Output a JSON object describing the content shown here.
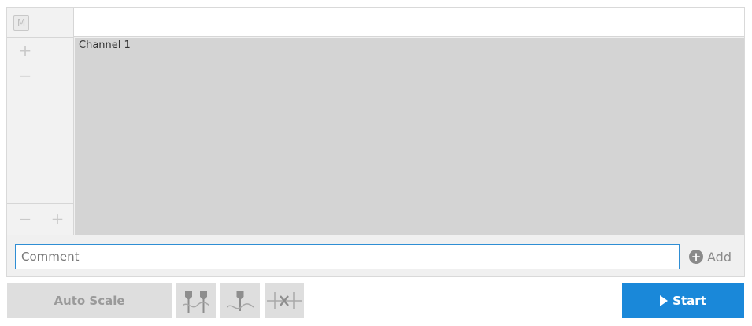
{
  "sidebar": {
    "mode_badge": "M",
    "zoom_in_top": "+",
    "zoom_out_top": "−",
    "zoom_out_bottom": "−",
    "zoom_in_bottom": "+"
  },
  "plot": {
    "channel_label": "Channel 1"
  },
  "comment": {
    "placeholder": "Comment",
    "value": "",
    "add_label": "Add",
    "add_icon": "+"
  },
  "toolbar": {
    "autoscale_label": "Auto Scale",
    "tools": [
      "marker-pair-icon",
      "single-marker-icon",
      "clear-markers-icon"
    ],
    "start_label": "Start"
  },
  "colors": {
    "accent": "#1a88d9",
    "plot_bg": "#d4d4d4"
  }
}
